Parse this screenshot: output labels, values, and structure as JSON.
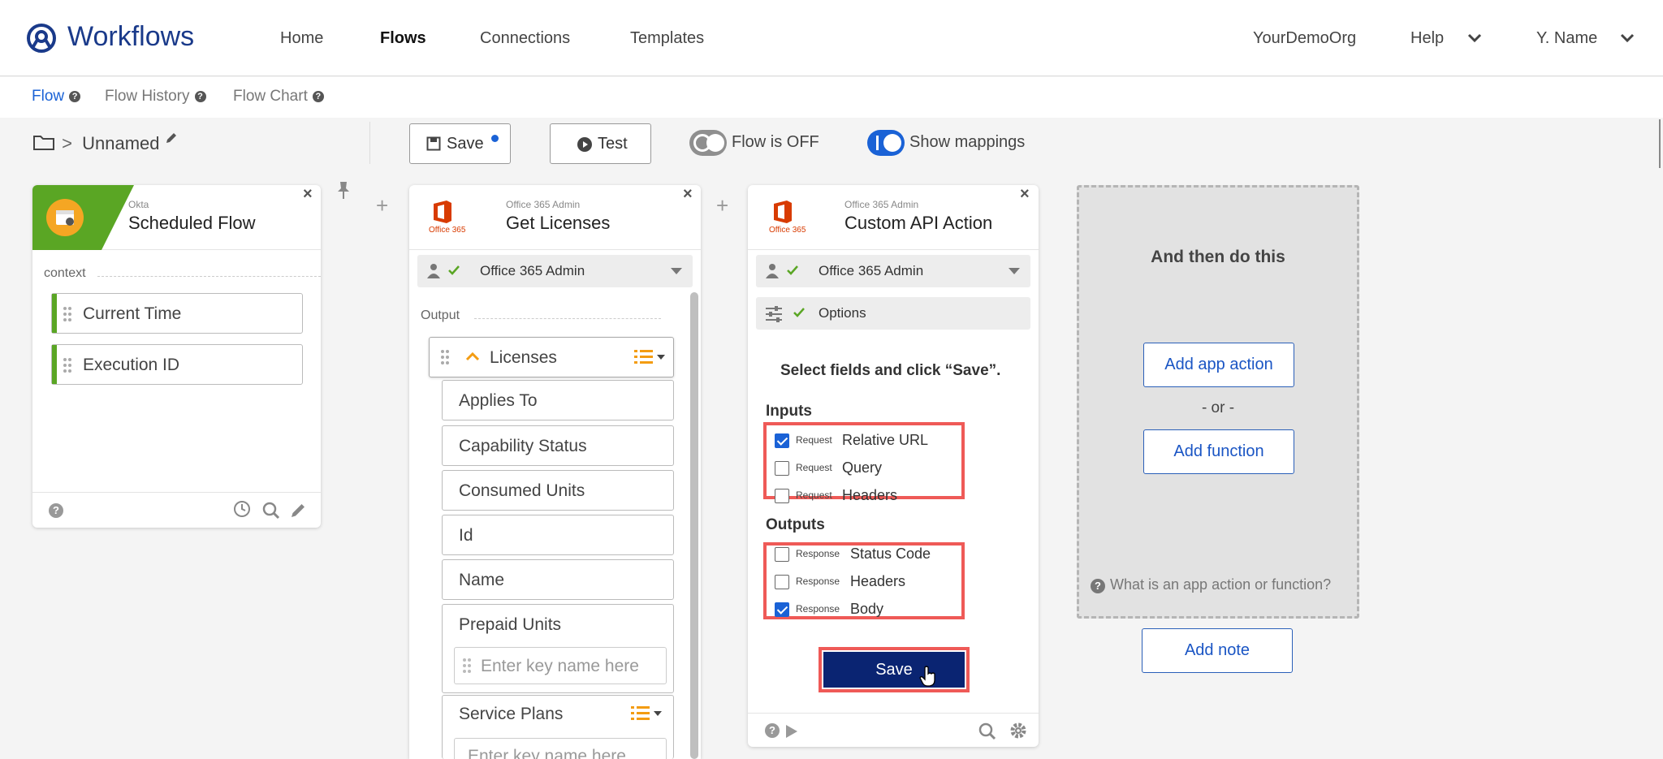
{
  "app": {
    "title": "Workflows"
  },
  "nav": {
    "home": "Home",
    "flows": "Flows",
    "connections": "Connections",
    "templates": "Templates",
    "org": "YourDemoOrg",
    "help": "Help",
    "user": "Y. Name"
  },
  "subnav": {
    "flow": "Flow",
    "history": "Flow History",
    "chart": "Flow Chart"
  },
  "toolbar": {
    "flow_name": "Unnamed",
    "save": "Save",
    "test": "Test",
    "flow_status": "Flow is OFF",
    "show_mappings": "Show mappings"
  },
  "card1": {
    "vendor": "Okta",
    "title": "Scheduled Flow",
    "section": "context",
    "fields": [
      "Current Time",
      "Execution ID"
    ]
  },
  "card2": {
    "vendor": "Office 365 Admin",
    "title": "Get Licenses",
    "logo_text": "Office 365",
    "connection": "Office 365 Admin",
    "section": "Output",
    "list_label": "Licenses",
    "fields": [
      "Applies To",
      "Capability Status",
      "Consumed Units",
      "Id",
      "Name",
      "Prepaid Units"
    ],
    "key_placeholder": "Enter key name here",
    "service_plans": "Service Plans",
    "key_placeholder2": "Enter key name here"
  },
  "card3": {
    "vendor": "Office 365 Admin",
    "title": "Custom API Action",
    "logo_text": "Office 365",
    "connection": "Office 365 Admin",
    "options": "Options",
    "instruction": "Select fields and click “Save”.",
    "inputs_label": "Inputs",
    "inputs": [
      {
        "tag": "Request",
        "label": "Relative URL",
        "checked": true
      },
      {
        "tag": "Request",
        "label": "Query",
        "checked": false
      },
      {
        "tag": "Request",
        "label": "Headers",
        "checked": false
      }
    ],
    "outputs_label": "Outputs",
    "outputs": [
      {
        "tag": "Response",
        "label": "Status Code",
        "checked": false
      },
      {
        "tag": "Response",
        "label": "Headers",
        "checked": false
      },
      {
        "tag": "Response",
        "label": "Body",
        "checked": true
      }
    ],
    "save": "Save"
  },
  "next": {
    "heading": "And then do this",
    "add_action": "Add app action",
    "or": "- or -",
    "add_function": "Add function",
    "help": "What is an app action or function?",
    "add_note": "Add note"
  },
  "colors": {
    "brand": "#1a3a8a",
    "link": "#1a62d6",
    "okta_green": "#5aa624",
    "office_red": "#d83b01",
    "highlight": "#ef5a57",
    "save_navy": "#0a2472"
  }
}
